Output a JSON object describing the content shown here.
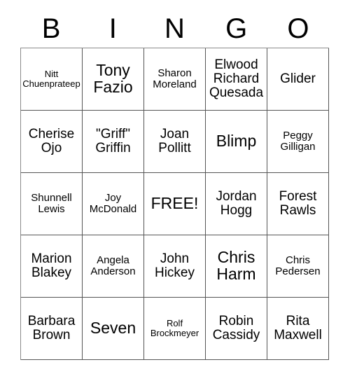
{
  "card": {
    "title": "BINGO",
    "header_letters": [
      "B",
      "I",
      "N",
      "G",
      "O"
    ],
    "free_space_label": "FREE!",
    "columns": 5,
    "rows": 5,
    "grid_line_color": "#555555",
    "text_color": "#000000",
    "background_color": "#ffffff",
    "cells": [
      [
        {
          "text": "Nitt Chuenprateep",
          "is_free": false
        },
        {
          "text": "Tony Fazio",
          "is_free": false
        },
        {
          "text": "Sharon Moreland",
          "is_free": false
        },
        {
          "text": "Elwood Richard Quesada",
          "is_free": false
        },
        {
          "text": "Glider",
          "is_free": false
        }
      ],
      [
        {
          "text": "Cherise Ojo",
          "is_free": false
        },
        {
          "text": "\"Griff\" Griffin",
          "is_free": false
        },
        {
          "text": "Joan Pollitt",
          "is_free": false
        },
        {
          "text": "Blimp",
          "is_free": false
        },
        {
          "text": "Peggy Gilligan",
          "is_free": false
        }
      ],
      [
        {
          "text": "Shunnell Lewis",
          "is_free": false
        },
        {
          "text": "Joy McDonald",
          "is_free": false
        },
        {
          "text": "FREE!",
          "is_free": true
        },
        {
          "text": "Jordan Hogg",
          "is_free": false
        },
        {
          "text": "Forest Rawls",
          "is_free": false
        }
      ],
      [
        {
          "text": "Marion Blakey",
          "is_free": false
        },
        {
          "text": "Angela Anderson",
          "is_free": false
        },
        {
          "text": "John Hickey",
          "is_free": false
        },
        {
          "text": "Chris Harm",
          "is_free": false
        },
        {
          "text": "Chris Pedersen",
          "is_free": false
        }
      ],
      [
        {
          "text": "Barbara Brown",
          "is_free": false
        },
        {
          "text": "Seven",
          "is_free": false
        },
        {
          "text": "Rolf Brockmeyer",
          "is_free": false
        },
        {
          "text": "Robin Cassidy",
          "is_free": false
        },
        {
          "text": "Rita Maxwell",
          "is_free": false
        }
      ]
    ]
  }
}
